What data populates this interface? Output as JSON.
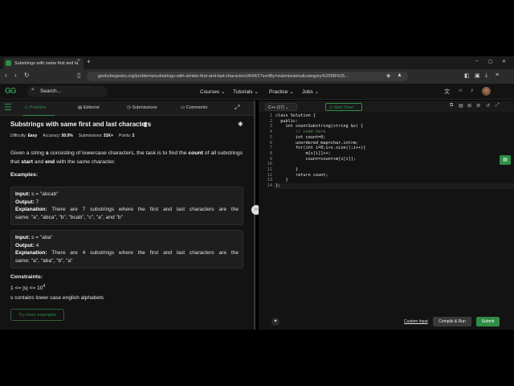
{
  "browser": {
    "tab_title": "Substrings with same first and la",
    "url": "geeksforgeeks.org/problems/substrings-with-similar-first-and-last-characters3644/1?sortBy=submissions&category%255B%25..."
  },
  "site": {
    "logo": "GG",
    "search_placeholder": "Search...",
    "nav": [
      "Courses",
      "Tutorials",
      "Practice",
      "Jobs"
    ]
  },
  "left_tabs": [
    "Problem",
    "Editorial",
    "Submissions",
    "Comments"
  ],
  "problem": {
    "title": "Substrings with same first and last characters",
    "difficulty_label": "Difficulty:",
    "difficulty": "Easy",
    "accuracy_label": "Accuracy:",
    "accuracy": "50.0%",
    "submissions_label": "Submissions:",
    "submissions": "31K+",
    "points_label": "Points:",
    "points": "2",
    "desc_1": "Given a string ",
    "desc_s": "s",
    "desc_2": " consisting of lowercase characters, the task is to find the ",
    "desc_count": "count",
    "desc_3": " of all substrings that ",
    "desc_start": "start",
    "desc_4": " and ",
    "desc_end": "end",
    "desc_5": " with the same character.",
    "examples_heading": "Examples:",
    "examples": [
      {
        "input_label": "Input:",
        "input": "s = \"abcab\"",
        "output_label": "Output:",
        "output": "7",
        "expl_label": "Explanation:",
        "expl_line1": "There are 7 substrings where the first and last characters are the",
        "expl_line2": "same: \"a\", \"abca\", \"b\", \"bcab\", \"c\", \"a\", and \"b\""
      },
      {
        "input_label": "Input:",
        "input": "s = \"aba\"",
        "output_label": "Output:",
        "output": "4",
        "expl_label": "Explanation:",
        "expl_line1": "There are 4 substrings where the first and last characters are the",
        "expl_line2": "same: \"a\", \"aba\", \"b\", \"a\""
      }
    ],
    "constraints_heading": "Constraints:",
    "constraint_1": "1 <= |s| <= 10",
    "constraint_1_exp": "4",
    "constraint_2": "s contains lower case english alphabets",
    "try_more": "Try more examples"
  },
  "editor": {
    "language": "C++ (17)",
    "timer_label": "Start Timer",
    "line_numbers": [
      "1",
      "2",
      "3",
      "4",
      "5",
      "6",
      "7",
      "8",
      "9",
      "10",
      "11",
      "12",
      "13",
      "14"
    ],
    "code_lines": [
      "class Solution {",
      "  public:",
      "    int countSubstring(string &s) {",
      "        // code here",
      "        int count=0;",
      "        unordered_map<char,int>m;",
      "        for(int i=0;i<s.size();i++){",
      "            m[s[i]]++;",
      "            count=count+m[s[i]];",
      "",
      "        }",
      "        return count;",
      "    }",
      "};"
    ],
    "custom_input": "Custom Input",
    "compile_run": "Compile & Run",
    "submit": "Submit"
  },
  "colors": {
    "accent": "#2f8d46",
    "bg": "#131313"
  }
}
